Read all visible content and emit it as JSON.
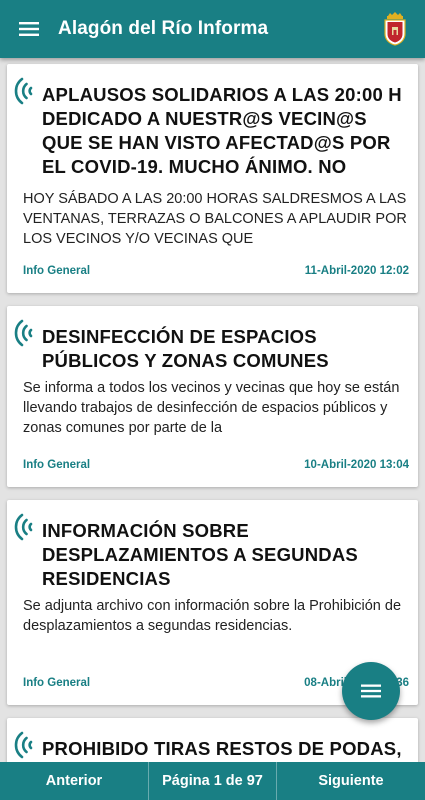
{
  "header": {
    "title": "Alagón del Río Informa",
    "menu_icon": "hamburger-menu-icon",
    "logo": "municipal-crest-logo"
  },
  "news": [
    {
      "title": "APLAUSOS SOLIDARIOS A LAS 20:00 H DEDICADO A NUESTR@S VECIN@S QUE SE HAN VISTO AFECTAD@S POR EL COVID-19. MUCHO ÁNIMO. NO",
      "text": "HOY SÁBADO A LAS 20:00 HORAS SALDRESMOS A LAS VENTANAS, TERRAZAS O BALCONES A APLAUDIR POR LOS VECINOS Y/O VECINAS QUE",
      "category": "Info General",
      "date": "11-Abril-2020 12:02"
    },
    {
      "title": "DESINFECCIÓN DE ESPACIOS PÚBLICOS Y ZONAS COMUNES",
      "text": "Se informa a todos los vecinos y vecinas que hoy se están llevando trabajos de desinfección de espacios públicos y zonas comunes por parte de la",
      "category": "Info General",
      "date": "10-Abril-2020 13:04"
    },
    {
      "title": "INFORMACIÓN SOBRE DESPLAZAMIENTOS A SEGUNDAS RESIDENCIAS",
      "text": "Se adjunta archivo con información sobre la Prohibición de desplazamientos a segundas residencias.",
      "category": "Info General",
      "date": "08-Abril-2020 12:36"
    },
    {
      "title": "PROHIBIDO TIRAS RESTOS DE PODAS,",
      "text": "",
      "category": "",
      "date": ""
    }
  ],
  "pagination": {
    "prev_label": "Anterior",
    "page_label": "Página 1 de 97",
    "next_label": "Siguiente"
  },
  "fab": {
    "icon": "list-menu-icon"
  },
  "colors": {
    "primary": "#197f84",
    "background": "#e3e3e3",
    "card": "#ffffff"
  }
}
